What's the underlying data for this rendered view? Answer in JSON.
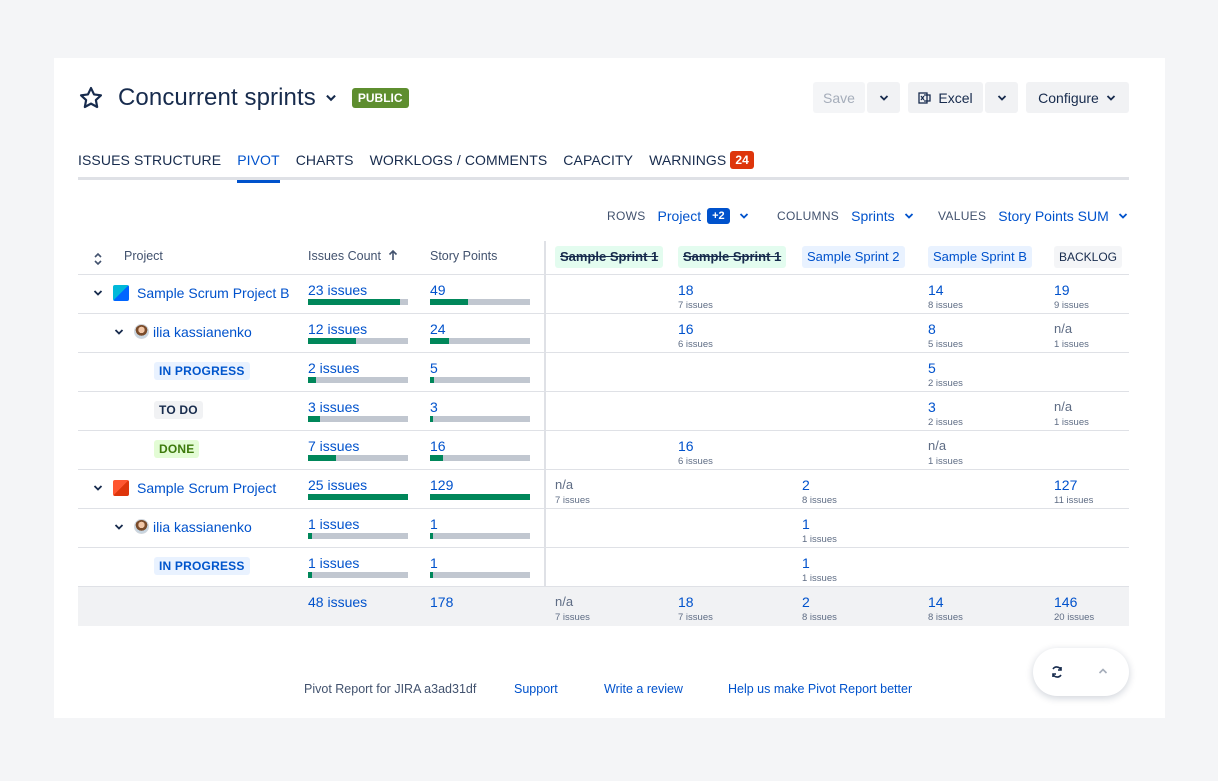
{
  "header": {
    "title": "Concurrent sprints",
    "public_badge": "PUBLIC",
    "save_label": "Save",
    "excel_label": "Excel",
    "configure_label": "Configure"
  },
  "tabs": [
    {
      "label": "ISSUES STRUCTURE"
    },
    {
      "label": "PIVOT"
    },
    {
      "label": "CHARTS"
    },
    {
      "label": "WORKLOGS / COMMENTS"
    },
    {
      "label": "CAPACITY"
    },
    {
      "label": "WARNINGS",
      "count": "24"
    }
  ],
  "config": {
    "rows_label": "ROWS",
    "rows_value": "Project",
    "rows_extra": "+2",
    "columns_label": "COLUMNS",
    "columns_value": "Sprints",
    "values_label": "VALUES",
    "values_value": "Story Points SUM"
  },
  "table": {
    "headers": {
      "project": "Project",
      "issues_count": "Issues Count",
      "story_points": "Story Points",
      "sprints": [
        "Sample Sprint 1",
        "Sample Sprint 1",
        "Sample Sprint 2",
        "Sample Sprint B",
        "BACKLOG"
      ]
    },
    "rows": [
      {
        "label": "Sample Scrum Project B",
        "issues": "23 issues",
        "issues_pct": 0.92,
        "sp": "49",
        "sp_pct": 0.38,
        "cells": [
          null,
          {
            "v": "18",
            "s": "7 issues"
          },
          null,
          {
            "v": "14",
            "s": "8 issues"
          },
          {
            "v": "19",
            "s": "9 issues"
          }
        ]
      },
      {
        "label": "ilia kassianenko",
        "issues": "12 issues",
        "issues_pct": 0.48,
        "sp": "24",
        "sp_pct": 0.19,
        "cells": [
          null,
          {
            "v": "16",
            "s": "6 issues"
          },
          null,
          {
            "v": "8",
            "s": "5 issues"
          },
          {
            "v": "n/a",
            "s": "1 issues"
          }
        ]
      },
      {
        "label": "IN PROGRESS",
        "issues": "2 issues",
        "issues_pct": 0.08,
        "sp": "5",
        "sp_pct": 0.04,
        "cells": [
          null,
          null,
          null,
          {
            "v": "5",
            "s": "2 issues"
          },
          null
        ]
      },
      {
        "label": "TO DO",
        "issues": "3 issues",
        "issues_pct": 0.12,
        "sp": "3",
        "sp_pct": 0.03,
        "cells": [
          null,
          null,
          null,
          {
            "v": "3",
            "s": "2 issues"
          },
          {
            "v": "n/a",
            "s": "1 issues"
          }
        ]
      },
      {
        "label": "DONE",
        "issues": "7 issues",
        "issues_pct": 0.28,
        "sp": "16",
        "sp_pct": 0.13,
        "cells": [
          null,
          {
            "v": "16",
            "s": "6 issues"
          },
          null,
          {
            "v": "n/a",
            "s": "1 issues"
          },
          null
        ]
      },
      {
        "label": "Sample Scrum Project",
        "issues": "25 issues",
        "issues_pct": 1.0,
        "sp": "129",
        "sp_pct": 1.0,
        "cells": [
          {
            "v": "n/a",
            "s": "7 issues"
          },
          null,
          {
            "v": "2",
            "s": "8 issues"
          },
          null,
          {
            "v": "127",
            "s": "11 issues"
          }
        ]
      },
      {
        "label": "ilia kassianenko",
        "issues": "1 issues",
        "issues_pct": 0.04,
        "sp": "1",
        "sp_pct": 0.02,
        "cells": [
          null,
          null,
          {
            "v": "1",
            "s": "1 issues"
          },
          null,
          null
        ]
      },
      {
        "label": "IN PROGRESS",
        "issues": "1 issues",
        "issues_pct": 0.04,
        "sp": "1",
        "sp_pct": 0.02,
        "cells": [
          null,
          null,
          {
            "v": "1",
            "s": "1 issues"
          },
          null,
          null
        ]
      }
    ],
    "total": {
      "issues": "48 issues",
      "sp": "178",
      "cells": [
        {
          "v": "n/a",
          "s": "7 issues"
        },
        {
          "v": "18",
          "s": "7 issues"
        },
        {
          "v": "2",
          "s": "8 issues"
        },
        {
          "v": "14",
          "s": "8 issues"
        },
        {
          "v": "146",
          "s": "20 issues"
        }
      ]
    }
  },
  "footer": {
    "version": "Pivot Report for JIRA a3ad31df",
    "support": "Support",
    "review": "Write a review",
    "improve": "Help us make Pivot Report better"
  },
  "colors": {
    "accent": "#0052cc",
    "bar_fill": "#00875a",
    "warning": "#de350b",
    "public": "#5e8e2f"
  },
  "icons": [
    "star-icon",
    "chevron-down-icon",
    "excel-icon",
    "sort-icon",
    "arrow-up-icon",
    "refresh-icon",
    "chevron-up-icon"
  ]
}
